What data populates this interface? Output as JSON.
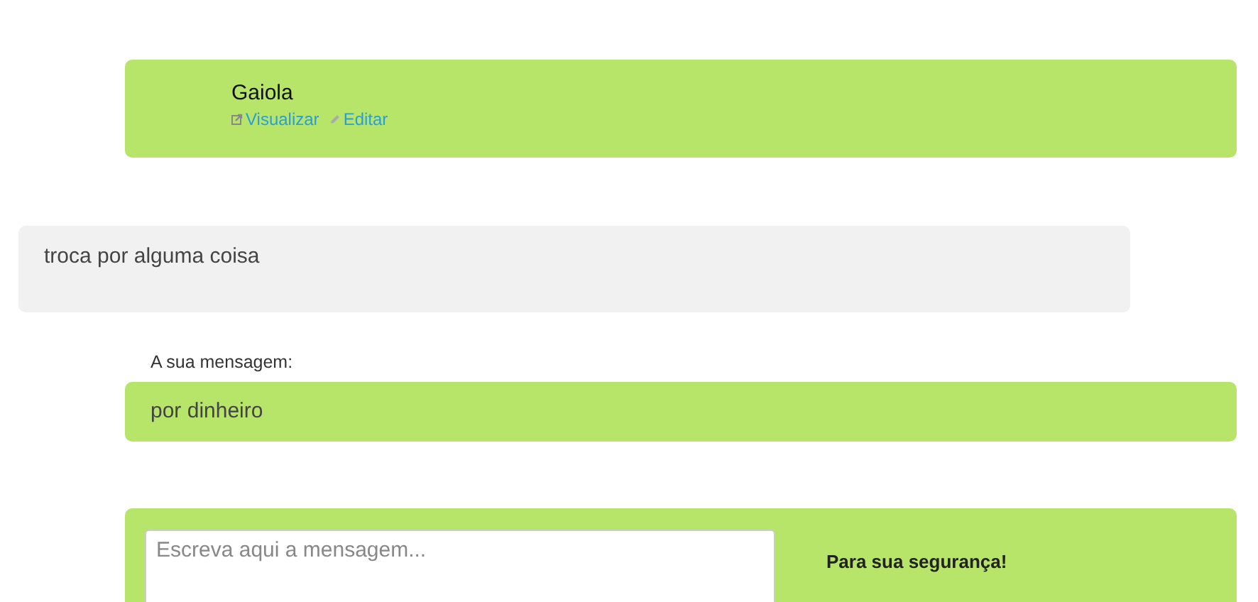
{
  "product": {
    "title": "Gaiola",
    "links": [
      {
        "kind": "view",
        "label": "Visualizar"
      },
      {
        "kind": "edit",
        "label": "Editar"
      }
    ]
  },
  "messages": [
    {
      "kind": "received",
      "text": "troca por alguma coisa"
    },
    {
      "kind": "sent",
      "label": "A sua mensagem:",
      "text": "por dinheiro"
    }
  ],
  "compose": {
    "placeholder": "Escreva aqui a mensagem...",
    "notice": "Para sua segurança!"
  }
}
